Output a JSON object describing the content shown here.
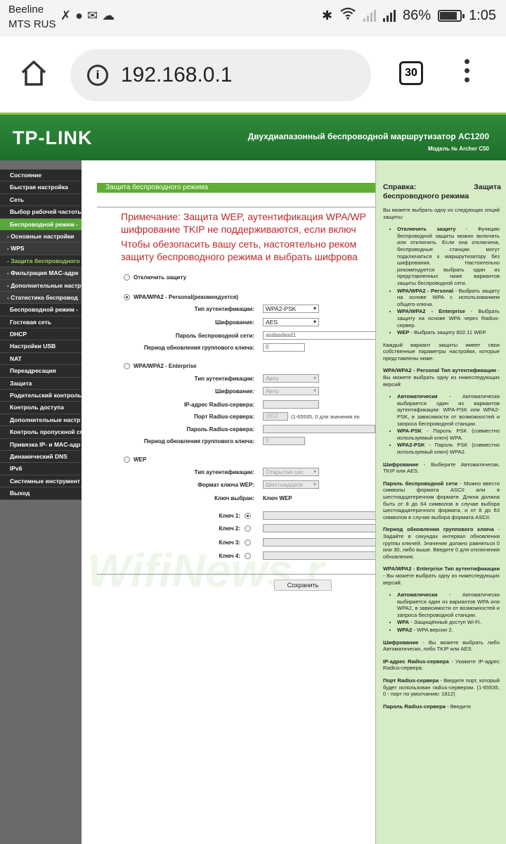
{
  "statusbar": {
    "carrier1": "Beeline",
    "carrier2": "MTS RUS",
    "icons": [
      "missed-call-icon",
      "chat-icon",
      "mail-icon",
      "cloud-icon"
    ],
    "battery": "86%",
    "battery_level": 0.86,
    "time": "1:05"
  },
  "browser": {
    "url": "192.168.0.1",
    "tab_count": "30"
  },
  "router": {
    "brand": "TP-LINK",
    "title": "Двухдиапазонный беспроводной маршрутизатор AC1200",
    "model": "Модель № Archer C50"
  },
  "sidebar": {
    "items": [
      "Состояние",
      "Быстрая настройка",
      "Сеть",
      "Выбор рабочей частоты",
      "Беспроводной режим -",
      "- Основные настройки",
      "- WPS",
      "- Защита беспроводного",
      "- Фильтрация MAC-адре",
      "- Дополнительные настр",
      "- Статистика беспровод",
      "Беспроводной режим -",
      "Гостевая сеть",
      "DHCP",
      "Настройки USB",
      "NAT",
      "Переадресация",
      "Защита",
      "Родительский контроль",
      "Контроль доступа",
      "Дополнительные настр",
      "Контроль пропускной сп",
      "Привязка IP- и MAC-адр",
      "Динамический DNS",
      "IPv6",
      "Системные инструмент",
      "Выход"
    ]
  },
  "content": {
    "section_title": "Защита беспроводного режима",
    "note_lines": [
      "Примечание: Защита WEP, аутентификация WPA/WP",
      "шифрование TKIP не поддерживаются, если включ",
      "Чтобы обезопасить вашу сеть, настоятельно реком",
      "защиту беспроводного режима и выбрать шифрова"
    ],
    "disable_label": "Отключить защиту",
    "personal_label": "WPA/WPA2 - Personal(рекомендуется)",
    "auth_label": "Тип аутентификации:",
    "enc_label": "Шифрование:",
    "pwd_label": "Пароль беспроводной сети:",
    "gk_label": "Период обновления группового ключа:",
    "personal_auth_value": "WPA2-PSK",
    "personal_enc_value": "AES",
    "personal_password": "asdasdasd1",
    "personal_gk": "0",
    "enterprise_label": "WPA/WPA2 - Enterprise",
    "ent_auth_value": "Авто",
    "ent_enc_value": "Авто",
    "radius_ip_label": "IP-адрес Radius-сервера:",
    "radius_port_label": "Порт Radius-сервера:",
    "radius_port_value": "1812",
    "radius_port_hint": "(1-65535, 0 для значения по",
    "radius_pwd_label": "Пароль Radius-сервера:",
    "ent_gk_value": "0",
    "wep_label": "WEP",
    "wep_auth_value": "Открытая сис",
    "key_format_label": "Формат ключа WEP:",
    "key_format_value": "Шестнадцате",
    "key_selected_label": "Ключ выбран:",
    "key_selected_value": "Ключ WEP",
    "key1": "Ключ 1:",
    "key2": "Ключ 2:",
    "key3": "Ключ 3:",
    "key4": "Ключ 4:",
    "save": "Сохранить",
    "watermark": "WifiNews.r"
  },
  "help": {
    "title_left": "Справка:",
    "title_right": "Защита",
    "title_line2": "беспроводного режима",
    "intro": "Вы можете выбрать одну из следующих опций защиты:",
    "b1_bold": "Отключить защиту",
    "b1_text": " - Функцию беспроводной защиты можно включить или отключить. Если она отключена, беспроводные станции могут подключаться к маршрутизатору без шифрования. Настоятельно рекомендуется выбрать один из представленных ниже вариантов защиты беспроводной сети.",
    "b2_bold": "WPA/WPA2 - Personal",
    "b2_text": " - Выбрать защиту на основе WPA с использованием общего ключа.",
    "b3_bold": "WPA/WPA2 - Enterprise",
    "b3_text": " - Выбрать защиту на основе WPA через Radius-сервер.",
    "b4_bold": "WEP",
    "b4_text": " - Выбрать защиту 802.11 WEP.",
    "p_each": "Каждый вариант защиты имеет свои собственные параметры настройки, которые представлены ниже:",
    "p_auth_bold": "WPA/WPA2 - Personal Тип аутентификации",
    "p_auth_text": " - Вы можете выбрать одну из нижеследующих версий:",
    "v1_bold": "Автоматически",
    "v1_text": " - Автоматически выбирается один из вариантов аутентификации: WPA-PSK или WPA2-PSK, в зависимости от возможностей и запроса беспроводной станции.",
    "v2_bold": "WPA-PSK",
    "v2_text": " - Пароль PSK (совместно используемый ключ) WPA.",
    "v3_bold": "WPA2-PSK",
    "v3_text": " - Пароль PSK (совместно используемый ключ) WPA2.",
    "p_enc_bold": "Шифрование",
    "p_enc_text": " - Выберите Автоматически, TKIP или AES.",
    "p_pwd_bold": "Пароль беспроводной сети",
    "p_pwd_text": " - Можно ввести символы формата ASCII или в шестнадцатеричном формате. Длина должна быть от 8 до 64 символов в случае выбора шестнадцатеричного формата, и от 8 до 63 символов в случае выбора формата ASCII.",
    "p_gk_bold": "Период обновления группового ключа",
    "p_gk_text": " - Задайте в секундах интервал обновления группы ключей. Значение должно равняться 0 или 30, либо выше. Введите 0 для отключения обновления.",
    "p_ent_bold": "WPA/WPA2 - Enterprise Тип аутентификации",
    "p_ent_text": " - Вы можете выбрать одну из нижеследующих версий:",
    "e1_bold": "Автоматически",
    "e1_text": " - Автоматически выбирается один из вариантов WPA или WPA2, в зависимости от возможностей и запроса беспроводной станции.",
    "e2_bold": "WPA",
    "e2_text": " - Защищённый доступ Wi-Fi.",
    "e3_bold": "WPA2",
    "e3_text": " - WPA версии 2.",
    "p_enc2_bold": "Шифрование",
    "p_enc2_text": " - Вы можете выбрать либо Автоматически, либо TKIP или AES.",
    "p_ip_bold": "IP-адрес Radius-сервера",
    "p_ip_text": " - Укажите IP-адрес Radius-сервера.",
    "p_port_bold": "Порт Radius-сервера",
    "p_port_text": " - Введите порт, который будет использован radius-сервером. (1-65535, 0 - порт по умолчанию: 1812)",
    "p_rpwd_bold": "Пароль Radius-сервера",
    "p_rpwd_text": " - Введите"
  }
}
